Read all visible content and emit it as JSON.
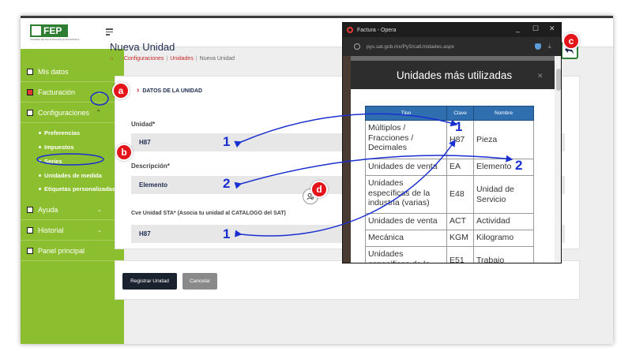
{
  "logo": {
    "name": "FEP",
    "sub": "SISTEMA DE FACTURACIÓN ELECTRÓNICA"
  },
  "sidebar": {
    "items": [
      {
        "label": "Mis datos"
      },
      {
        "label": "Facturación"
      },
      {
        "label": "Configuraciones"
      },
      {
        "label": "Ayuda"
      },
      {
        "label": "Historial"
      },
      {
        "label": "Panel principal"
      }
    ],
    "subitems": [
      {
        "label": "Preferencias"
      },
      {
        "label": "Impuestos"
      },
      {
        "label": "Series"
      },
      {
        "label": "Unidades de medida"
      },
      {
        "label": "Etiquetas personalizadas"
      }
    ]
  },
  "page": {
    "title": "Nueva Unidad",
    "breadcrumb": [
      "Configuraciones",
      "Unidades",
      "Nueva Unidad"
    ]
  },
  "form": {
    "section_title": "DATOS DE LA UNIDAD",
    "unidad_label": "Unidad*",
    "unidad_value": "H87",
    "descripcion_label": "Descripción*",
    "descripcion_value": "Elemento",
    "cve_label": "Cve Unidad STA* (Asocia tu unidad al CATALOGO del SAT)",
    "cve_value": "H87"
  },
  "buttons": {
    "register": "Registrar Unidad",
    "cancel": "Cancelar"
  },
  "popup": {
    "window_title": "Factura - Opera",
    "url": "pys.sat.gob.mx/PyS/catUnidades.aspx",
    "modal_title": "Unidades más utilizadas",
    "columns": [
      "Tipo",
      "Clave",
      "Nombre"
    ],
    "rows": [
      {
        "tipo": "Múltiplos / Fracciones / Decimales",
        "clave": "H87",
        "nombre": "Pieza"
      },
      {
        "tipo": "Unidades de venta",
        "clave": "EA",
        "nombre": "Elemento"
      },
      {
        "tipo": "Unidades específicas de la industria (varias)",
        "clave": "E48",
        "nombre": "Unidad de Servicio"
      },
      {
        "tipo": "Unidades de venta",
        "clave": "ACT",
        "nombre": "Actividad"
      },
      {
        "tipo": "Mecánica",
        "clave": "KGM",
        "nombre": "Kilogramo"
      },
      {
        "tipo": "Unidades específicas de la",
        "clave": "E51",
        "nombre": "Trabajo"
      }
    ]
  },
  "annotations": {
    "a": "a",
    "b": "b",
    "c": "c",
    "d": "d",
    "n1": "1",
    "n2": "2"
  },
  "colors": {
    "sidebar": "#8cbf2f",
    "accent_red": "#e3141a",
    "annotation_blue": "#1a2fd0",
    "table_header": "#2f6fb0"
  }
}
